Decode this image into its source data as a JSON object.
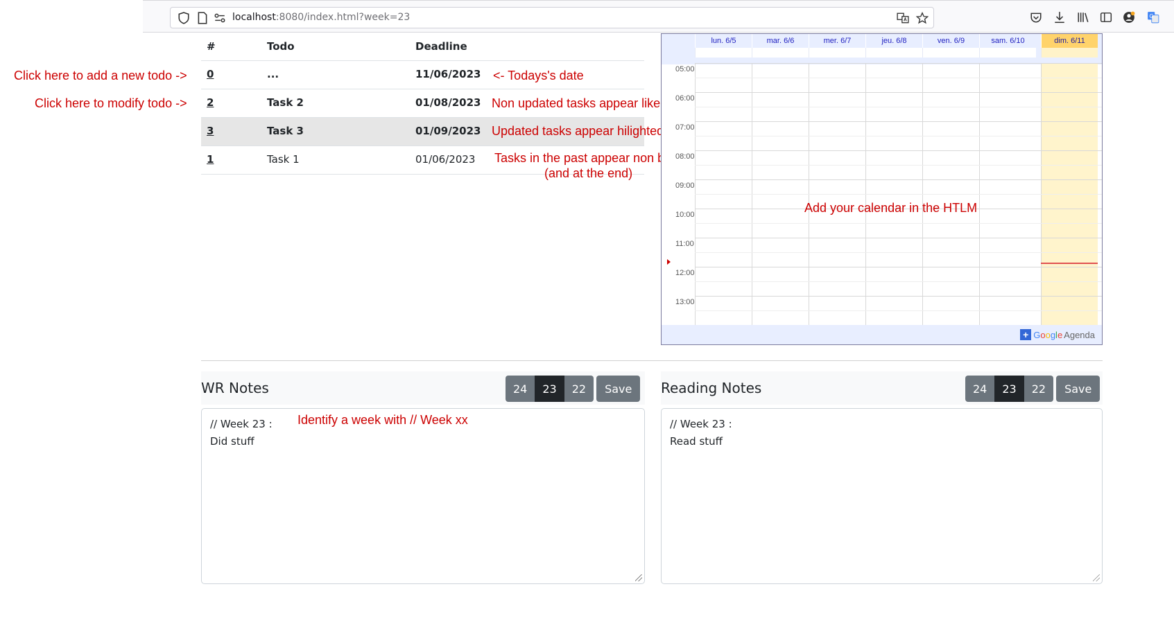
{
  "browser": {
    "url_host": "localhost",
    "url_path": ":8080/index.html?week=23"
  },
  "todo_table": {
    "headers": {
      "num": "#",
      "todo": "Todo",
      "deadline": "Deadline"
    },
    "rows": [
      {
        "num": "0",
        "todo": "...",
        "deadline": "11/06/2023",
        "style": "bold"
      },
      {
        "num": "2",
        "todo": "Task 2",
        "deadline": "01/08/2023",
        "style": "bold"
      },
      {
        "num": "3",
        "todo": "Task 3",
        "deadline": "01/09/2023",
        "style": "bold-highlight"
      },
      {
        "num": "1",
        "todo": "Task 1",
        "deadline": "01/06/2023",
        "style": "normal"
      }
    ]
  },
  "annotations": {
    "add_todo": "Click here to add a new todo ->",
    "modify_todo": "Click here to modify todo ->",
    "todays_date": "<- Todays's date",
    "non_updated": "Non updated tasks appear like this",
    "updated": "Updated tasks appear hilighted",
    "past_line1": "Tasks in the past appear non bold",
    "past_line2": "(and at the end)",
    "calendar": "Add your calendar in the HTLM",
    "week_marker": "Identify a week with // Week xx"
  },
  "calendar": {
    "days": [
      "lun. 6/5",
      "mar. 6/6",
      "mer. 6/7",
      "jeu. 6/8",
      "ven. 6/9",
      "sam. 6/10",
      "dim. 6/11"
    ],
    "today_index": 6,
    "hours": [
      "05:00",
      "06:00",
      "07:00",
      "08:00",
      "09:00",
      "10:00",
      "11:00",
      "12:00",
      "13:00"
    ],
    "footer_google": [
      "G",
      "o",
      "o",
      "g",
      "l",
      "e"
    ],
    "footer_agenda": "Agenda",
    "footer_plus": "+"
  },
  "wr_notes": {
    "title": "WR Notes",
    "weeks": [
      "24",
      "23",
      "22"
    ],
    "active_week": "23",
    "save_label": "Save",
    "content": "// Week 23 :\nDid stuff"
  },
  "reading_notes": {
    "title": "Reading Notes",
    "weeks": [
      "24",
      "23",
      "22"
    ],
    "active_week": "23",
    "save_label": "Save",
    "content": "// Week 23 :\nRead stuff"
  },
  "colors": {
    "annotation": "#cc0000",
    "button": "#6c757d",
    "button_active": "#212529",
    "today_header": "#ffd36b",
    "today_column": "#fff4cc",
    "highlight_row": "#e6e6e6"
  }
}
